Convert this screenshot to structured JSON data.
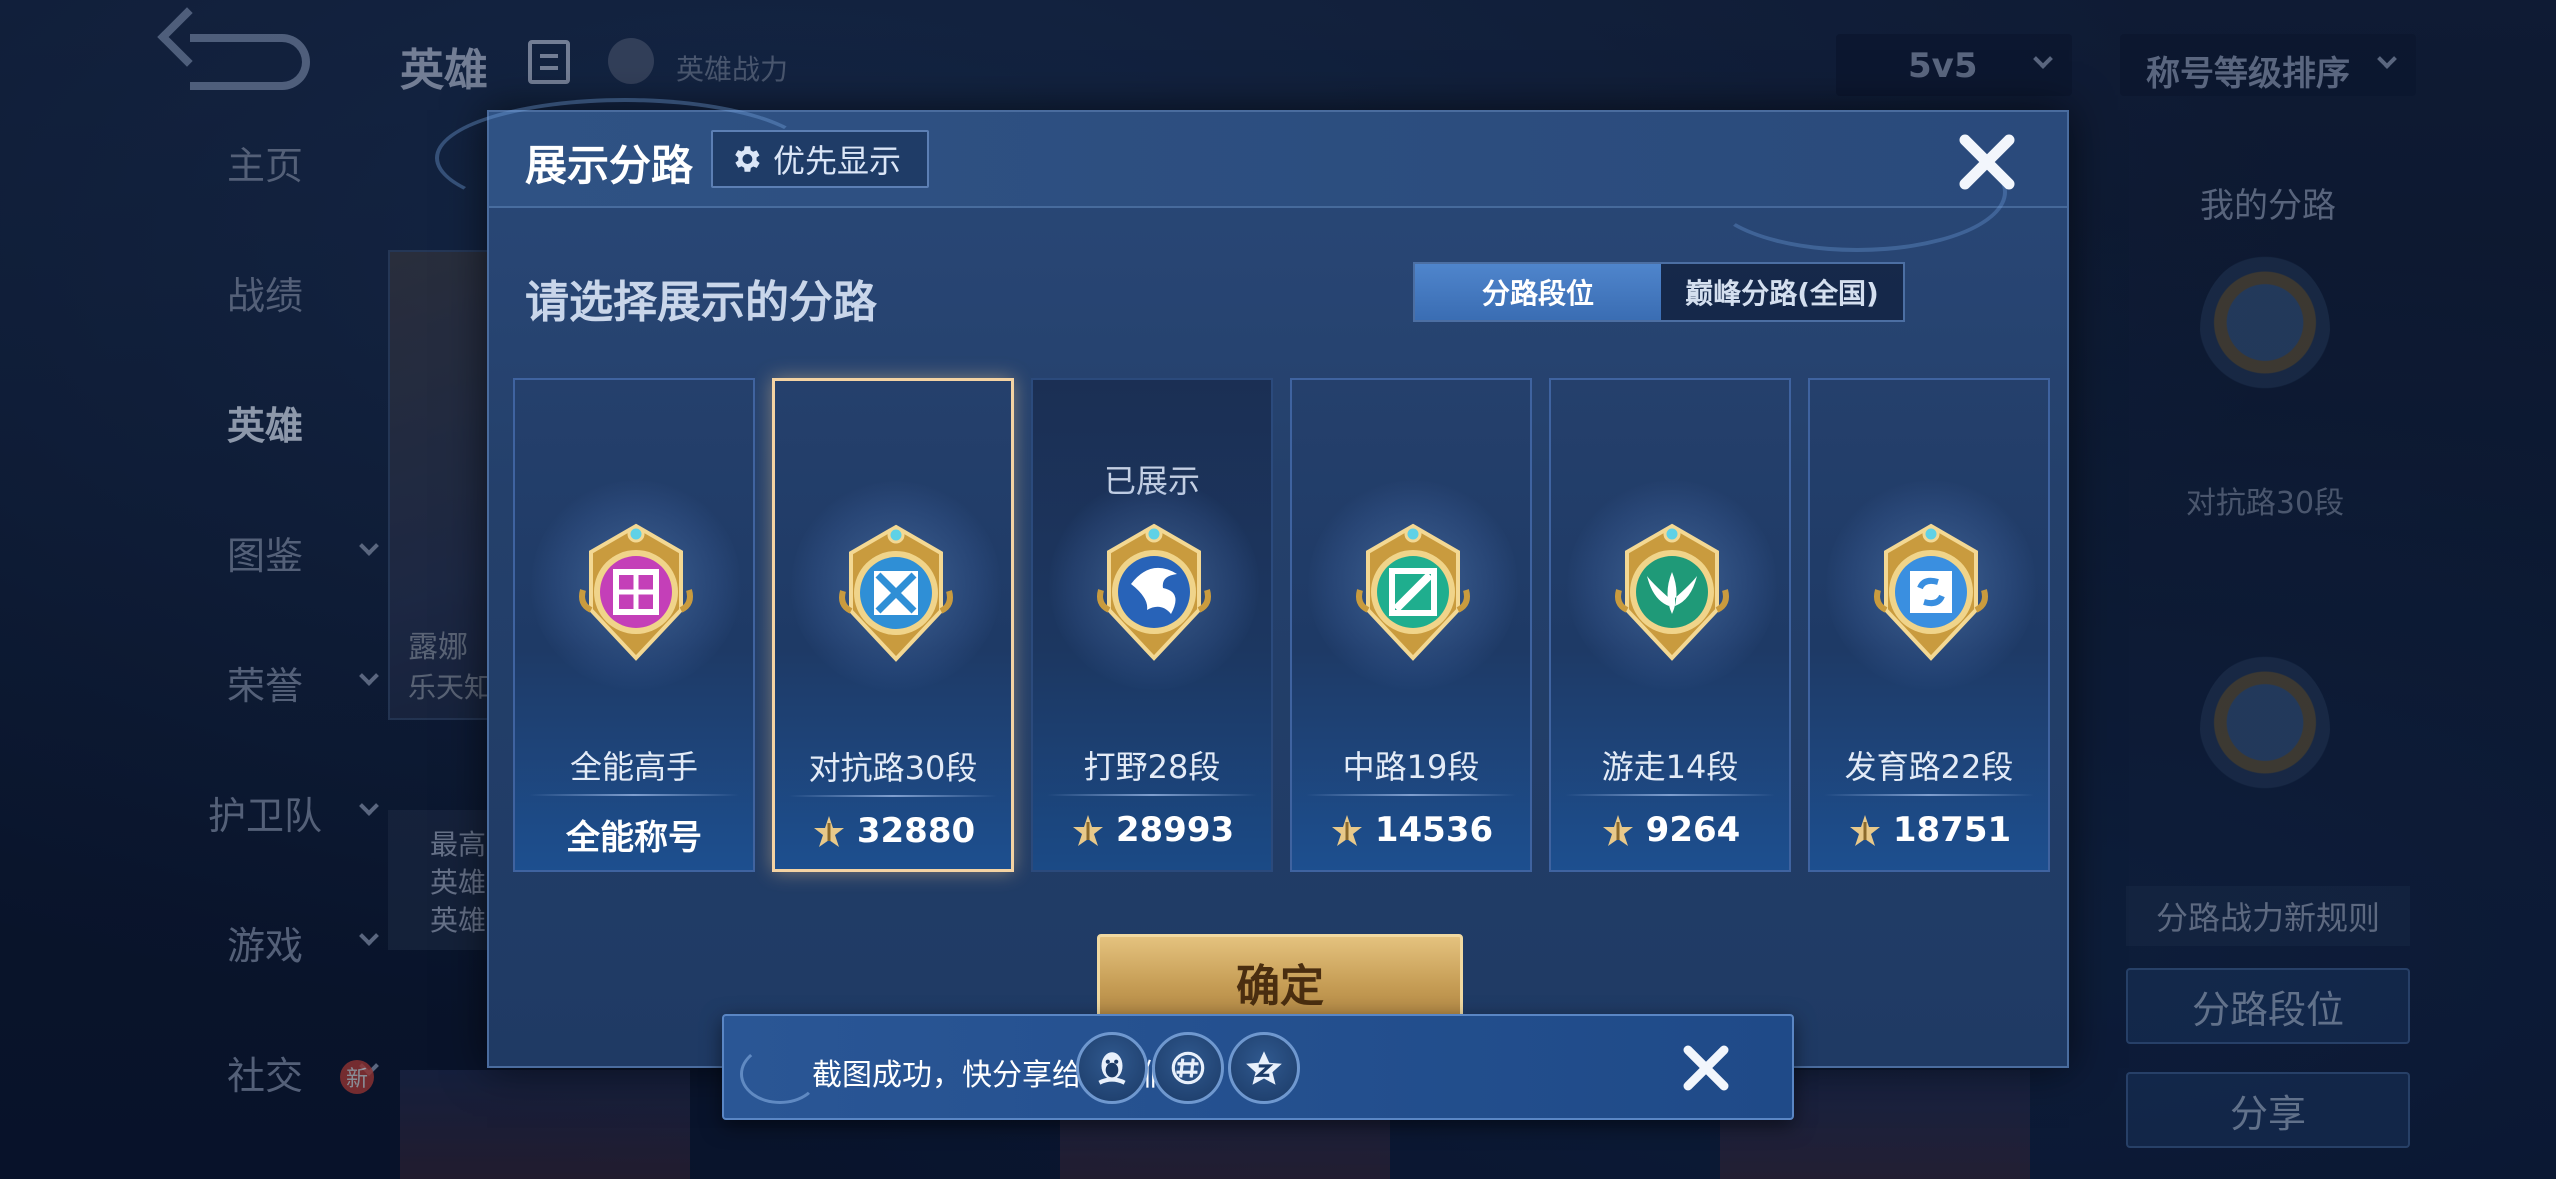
{
  "background": {
    "page_title": "英雄",
    "hero_power_label": "英雄战力",
    "mode_select": "5v5",
    "sort_select": "称号等级排序",
    "nav": [
      {
        "label": "主页",
        "active": false,
        "has_chevron": false
      },
      {
        "label": "战绩",
        "active": false,
        "has_chevron": false
      },
      {
        "label": "英雄",
        "active": true,
        "has_chevron": false
      },
      {
        "label": "图鉴",
        "active": false,
        "has_chevron": true
      },
      {
        "label": "荣誉",
        "active": false,
        "has_chevron": true
      },
      {
        "label": "护卫队",
        "active": false,
        "has_chevron": true
      },
      {
        "label": "游戏",
        "active": false,
        "has_chevron": true
      },
      {
        "label": "社交",
        "active": false,
        "has_chevron": true
      }
    ],
    "new_badge": "新",
    "hero_card": {
      "name": "露娜",
      "subtitle": "乐天知"
    },
    "hero_info_lines": [
      "最高",
      "英雄",
      "英雄"
    ],
    "right_panel": {
      "title": "我的分路",
      "current_rank": "对抗路30段",
      "rule_button": "分路战力新规则",
      "lane_button": "分路段位",
      "share_button": "分享"
    }
  },
  "modal": {
    "title": "展示分路",
    "priority_button": "优先显示",
    "subtitle": "请选择展示的分路",
    "tabs": [
      {
        "label": "分路段位",
        "active": true
      },
      {
        "label": "巅峰分路(全国)",
        "active": false
      }
    ],
    "lanes": [
      {
        "rank": "全能高手",
        "value": "全能称号",
        "has_power_icon": false,
        "shown": false,
        "selected": false,
        "emblem_color": "#c43fb8",
        "emblem": "allround-emblem-icon"
      },
      {
        "rank": "对抗路30段",
        "value": "32880",
        "has_power_icon": true,
        "shown": false,
        "selected": true,
        "emblem_color": "#2f8fd6",
        "emblem": "clash-lane-emblem-icon"
      },
      {
        "rank": "打野28段",
        "value": "28993",
        "has_power_icon": true,
        "shown": true,
        "shown_label": "已展示",
        "selected": false,
        "emblem_color": "#2863b8",
        "emblem": "jungle-emblem-icon"
      },
      {
        "rank": "中路19段",
        "value": "14536",
        "has_power_icon": true,
        "shown": false,
        "selected": false,
        "emblem_color": "#1fae8e",
        "emblem": "mid-lane-emblem-icon"
      },
      {
        "rank": "游走14段",
        "value": "9264",
        "has_power_icon": true,
        "shown": false,
        "selected": false,
        "emblem_color": "#1f9a78",
        "emblem": "roam-emblem-icon"
      },
      {
        "rank": "发育路22段",
        "value": "18751",
        "has_power_icon": true,
        "shown": false,
        "selected": false,
        "emblem_color": "#3a8fe0",
        "emblem": "farm-lane-emblem-icon"
      }
    ],
    "confirm_button": "确定"
  },
  "share_toast": {
    "message": "截图成功，快分享给朋友们吧!",
    "targets": [
      "qq-icon",
      "moments-icon",
      "qzone-icon"
    ]
  },
  "colors": {
    "accent_gold": "#e4c27e",
    "selected_border": "#f4d3a3",
    "active_tab": "#4f85cc"
  }
}
